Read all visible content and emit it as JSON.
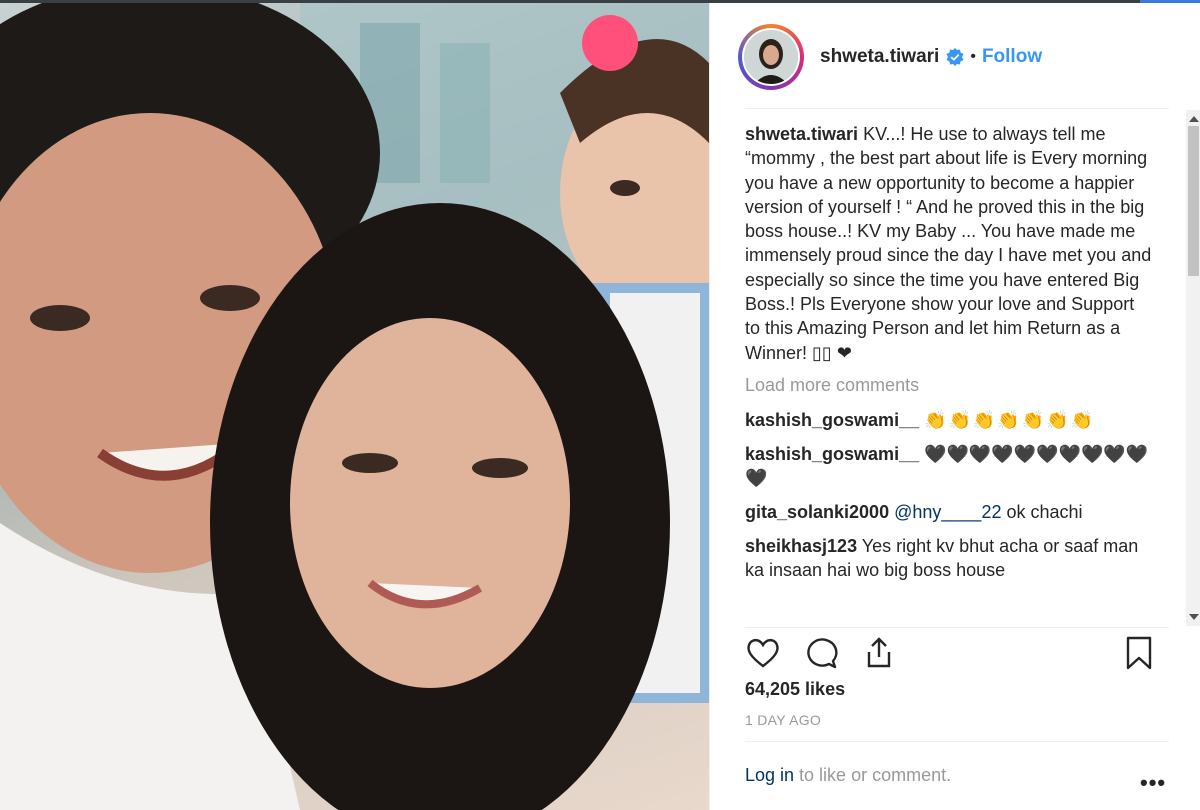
{
  "post": {
    "username": "shweta.tiwari",
    "follow_label": "Follow",
    "separator": "•",
    "caption_user": "shweta.tiwari",
    "caption_text": "KV...! He use to always tell me “mommy , the best part about life is Every morning you have a new opportunity to become a happier version of yourself ! “ And he proved this in the big boss house..! KV my Baby ... You have made me immensely proud since the day I have met you and especially so since the time you have entered Big Boss.! Pls Everyone show your love and Support to this Amazing Person and let him Return as a Winner! ▯▯ ❤",
    "load_more": "Load more comments",
    "comments": [
      {
        "user": "kashish_goswami__",
        "text": "👏👏👏👏👏👏👏"
      },
      {
        "user": "kashish_goswami__",
        "text": "🖤🖤🖤🖤🖤🖤🖤🖤🖤🖤🖤"
      },
      {
        "user": "gita_solanki2000",
        "mention": "@hny____22",
        "text": " ok chachi"
      },
      {
        "user": "sheikhasj123",
        "text": "Yes right kv bhut acha or saaf man ka insaan hai wo big boss house"
      }
    ],
    "likes": "64,205 likes",
    "time_ago": "1 DAY AGO",
    "login_link": "Log in",
    "login_text": " to like or comment.",
    "more_label": "•••"
  },
  "icons": {
    "like": "heart-icon",
    "comment": "comment-bubble-icon",
    "share": "share-icon",
    "save": "bookmark-icon",
    "verified": "verified-badge-icon"
  },
  "colors": {
    "link_blue": "#3897f0",
    "dark_link": "#003569",
    "muted": "#999999",
    "text": "#262626"
  }
}
